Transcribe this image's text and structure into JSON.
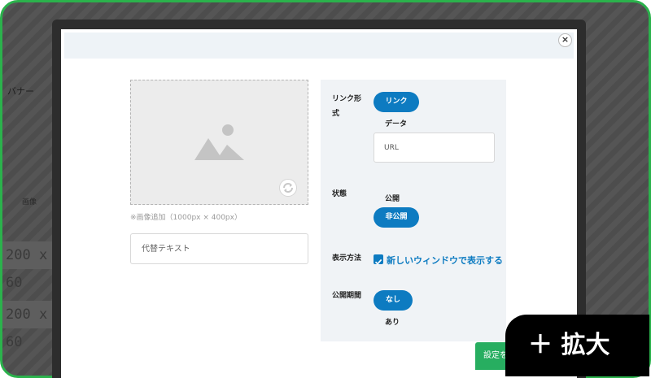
{
  "background": {
    "banner_label": "バナー",
    "image_label": "画像",
    "size_rows": [
      "200 x 60",
      "200 x 60"
    ]
  },
  "modal": {
    "close_symbol": "×",
    "image": {
      "placeholder_icon": "image-placeholder-icon",
      "rotate_icon": "rotate-icon",
      "note": "※画像追加（1000px × 400px）"
    },
    "alt_text": {
      "placeholder": "代替テキスト",
      "value": ""
    },
    "settings": {
      "link_format": {
        "label": "リンク形式",
        "options": [
          "リンク",
          "データ"
        ],
        "selected": "リンク",
        "url_placeholder": "URL"
      },
      "status": {
        "label": "状態",
        "options": [
          "公開",
          "非公開"
        ],
        "selected": "非公開"
      },
      "display_method": {
        "label": "表示方法",
        "checkbox_label": "新しいウィンドウで表示する",
        "checked": true
      },
      "publish_period": {
        "label": "公開期間",
        "options": [
          "なし",
          "あり"
        ],
        "selected": "なし"
      }
    },
    "submit_label": "設定を"
  },
  "zoom_badge": {
    "label": "＋ 拡大"
  },
  "colors": {
    "accent": "#0d7bc1",
    "submit": "#27ae60",
    "frame": "#2bb24c"
  }
}
